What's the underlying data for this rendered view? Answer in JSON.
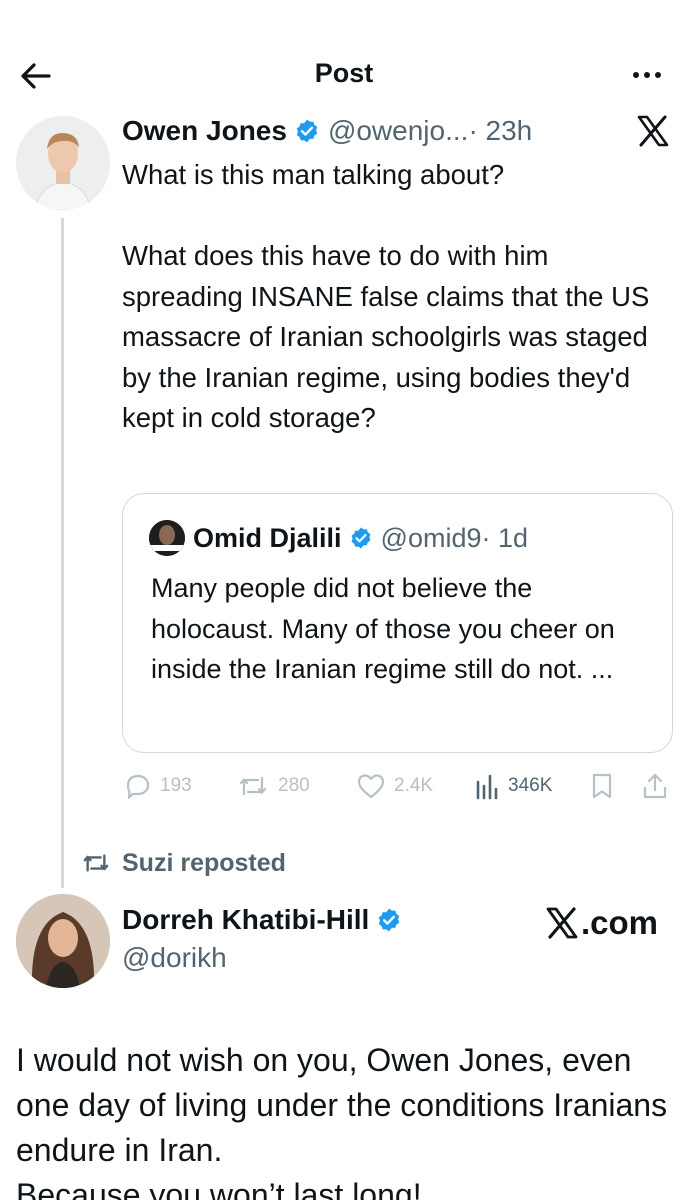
{
  "header": {
    "title": "Post",
    "back_icon": "back-arrow-icon",
    "more_icon": "more-dots-icon"
  },
  "tweet": {
    "author_name": "Owen Jones",
    "author_handle": "@owenjo...",
    "time": "· 23h",
    "text": "What is this man talking about?\n\nWhat does this have to do with him spreading INSANE false claims that the US massacre of Iranian schoolgirls was staged by the Iranian regime, using bodies they'd kept in cold storage?",
    "quote": {
      "author_name": "Omid Djalili",
      "author_handle": "@omid9",
      "time": "· 1d",
      "text": "Many people did not believe the holocaust. Many of those you cheer on inside the Iranian regime still do not. ..."
    },
    "stats": {
      "replies": "193",
      "reposts": "280",
      "likes": "2.4K",
      "views": "346K"
    }
  },
  "repost_label": "Suzi reposted",
  "tweet2": {
    "author_name": "Dorreh Khatibi-Hill",
    "author_handle": "@dorikh",
    "brand": ".com",
    "text": "I would not wish on you, Owen Jones, even one day of living under the conditions Iranians endure in Iran.\nBecause you won’t last long!"
  },
  "colors": {
    "verified_blue": "#1d9bf0",
    "text": "#0f1419",
    "secondary_text": "#536471",
    "border": "#cfd9de"
  }
}
